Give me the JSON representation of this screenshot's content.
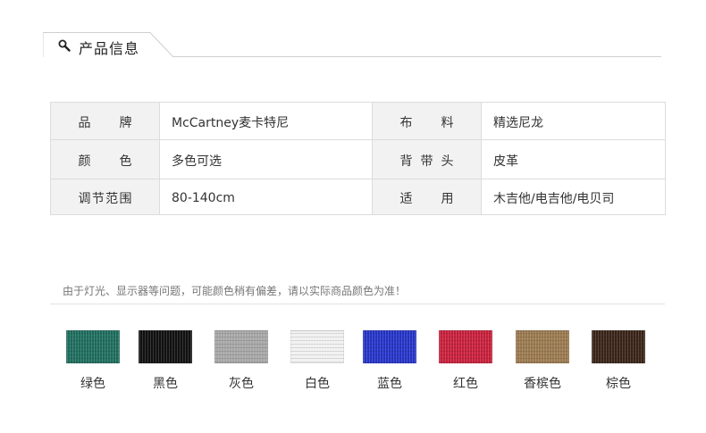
{
  "header": {
    "title": "产品信息",
    "icon": "magnifier-icon"
  },
  "spec_rows": [
    {
      "label1": "品牌",
      "value1": "McCartney麦卡特尼",
      "label2": "布料",
      "value2": "精选尼龙"
    },
    {
      "label1": "颜色",
      "value1": "多色可选",
      "label2": "背带头",
      "value2": "皮革"
    },
    {
      "label1": "调节范围",
      "value1": "80-140cm",
      "label2": "适用",
      "value2": "木吉他/电吉他/电贝司"
    }
  ],
  "notice": "由于灯光、显示器等问题，可能颜色稍有偏差，请以实际商品颜色为准！",
  "swatches": [
    {
      "name": "绿色",
      "color": "#1f6e5e"
    },
    {
      "name": "黑色",
      "color": "#111111"
    },
    {
      "name": "灰色",
      "color": "#a7a7a7"
    },
    {
      "name": "白色",
      "color": "#f1f1f1"
    },
    {
      "name": "蓝色",
      "color": "#2534c8"
    },
    {
      "name": "红色",
      "color": "#c8203c"
    },
    {
      "name": "香槟色",
      "color": "#9b7a50"
    },
    {
      "name": "棕色",
      "color": "#3a2418"
    }
  ]
}
